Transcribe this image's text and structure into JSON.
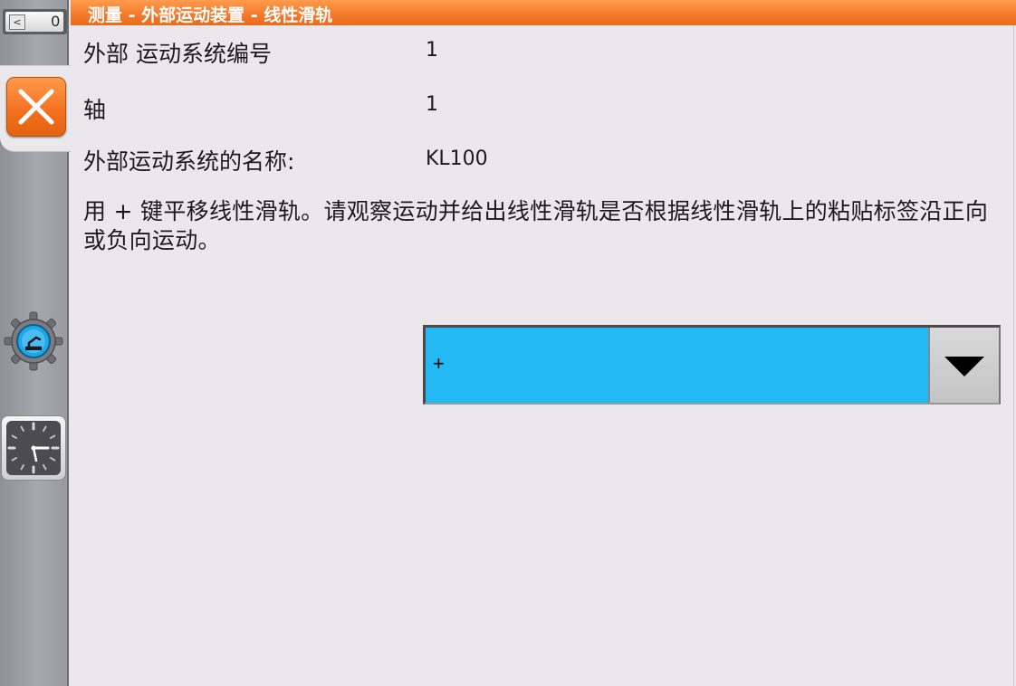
{
  "window": {
    "title": "测量 - 外部运动装置 - 线性滑轨"
  },
  "sidebar": {
    "counter_value": "0",
    "counter_arrow": "<",
    "close_icon": "close-x-icon",
    "gear_icon": "robot-gear-icon",
    "clock_icon": "clock-icon"
  },
  "form": {
    "fields": [
      {
        "label": "外部 运动系统编号",
        "value": "1"
      },
      {
        "label": "轴",
        "value": "1"
      },
      {
        "label": "外部运动系统的名称:",
        "value": "KL100"
      }
    ],
    "instruction": "用 + 键平移线性滑轨。请观察运动并给出线性滑轨是否根据线性滑轨上的粘贴标签沿正向或负向运动。",
    "direction_select": {
      "selected": "+"
    }
  },
  "colors": {
    "title_bar": "#f3782a",
    "close_button": "#f36f1e",
    "dropdown_selected": "#23b9f5",
    "background": "#eae8ea"
  }
}
